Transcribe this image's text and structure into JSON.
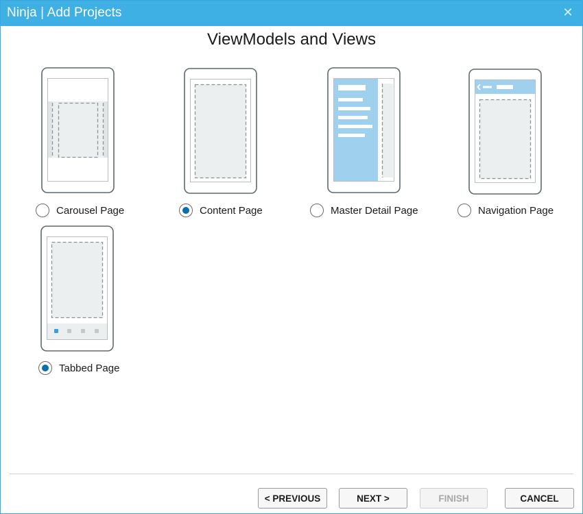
{
  "window": {
    "title": "Ninja | Add Projects",
    "close_glyph": "✕"
  },
  "heading": "ViewModels and Views",
  "options": [
    {
      "label": "Carousel Page",
      "selected": false,
      "icon": "carousel-page-icon"
    },
    {
      "label": "Content Page",
      "selected": true,
      "icon": "content-page-icon"
    },
    {
      "label": "Master Detail Page",
      "selected": false,
      "icon": "master-detail-page-icon"
    },
    {
      "label": "Navigation Page",
      "selected": false,
      "icon": "navigation-page-icon"
    },
    {
      "label": "Tabbed Page",
      "selected": true,
      "icon": "tabbed-page-icon"
    }
  ],
  "buttons": {
    "previous": "< PREVIOUS",
    "next": "NEXT >",
    "finish": "FINISH",
    "cancel": "CANCEL"
  },
  "colors": {
    "titlebar": "#3fb0e4",
    "radio_selected": "#0a6ea8",
    "accent_panel": "#9fd0ee"
  }
}
